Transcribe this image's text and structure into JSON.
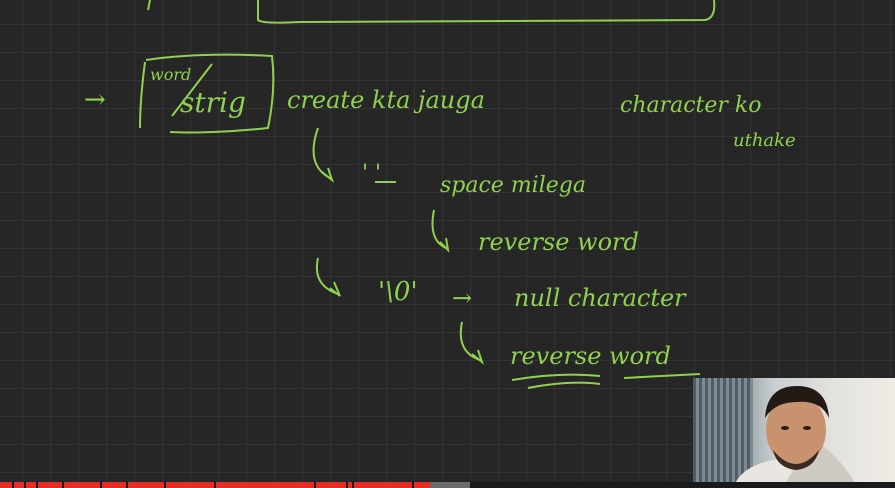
{
  "board": {
    "line1": {
      "bullet": "→",
      "box_top": "word",
      "box_main": "strig",
      "text": "create kta jauga",
      "tail": "character ko",
      "tail2": "uthake"
    },
    "line2": {
      "char": "' '",
      "arrow": "→",
      "text": "space milega"
    },
    "line3": {
      "text": "reverse word"
    },
    "line4": {
      "char": "'\\0'",
      "arrow": "→",
      "text": "null character"
    },
    "line5": {
      "text": "reverse word"
    }
  },
  "video": {
    "progress_fraction": 0.48
  },
  "colors": {
    "ink": "#8fd14f",
    "background": "#262626",
    "grid": "#333333",
    "progress_played": "#e52d27"
  }
}
